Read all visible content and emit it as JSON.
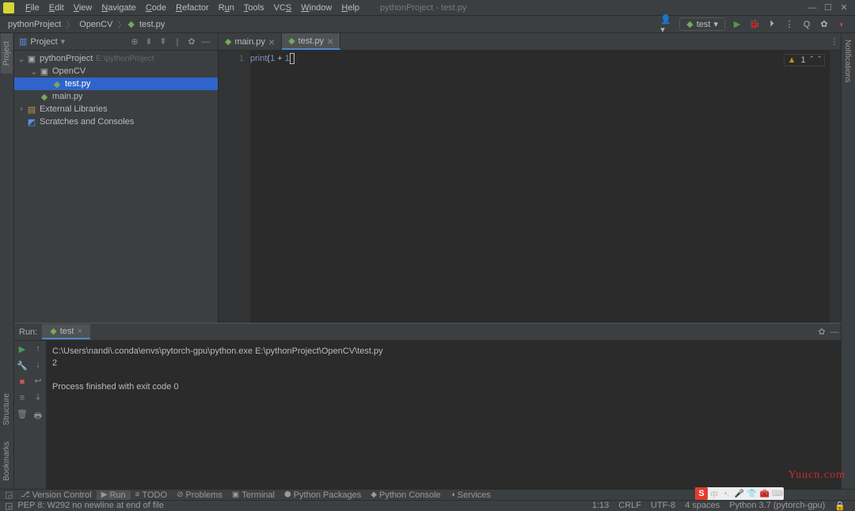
{
  "window": {
    "title": "pythonProject - test.py"
  },
  "menu": {
    "file": "File",
    "edit": "Edit",
    "view": "View",
    "navigate": "Navigate",
    "code": "Code",
    "refactor": "Refactor",
    "run": "Run",
    "tools": "Tools",
    "vcs": "VCS",
    "window": "Window",
    "help": "Help"
  },
  "breadcrumbs": {
    "p0": "pythonProject",
    "p1": "OpenCV",
    "p2": "test.py"
  },
  "run_config": {
    "name": "test"
  },
  "project_panel": {
    "title": "Project",
    "root": {
      "name": "pythonProject",
      "path": "E:\\pythonProject"
    },
    "opencv": "OpenCV",
    "testpy": "test.py",
    "mainpy": "main.py",
    "ext": "External Libraries",
    "scratches": "Scratches and Consoles"
  },
  "editor": {
    "tabs": [
      {
        "name": "main.py",
        "active": false
      },
      {
        "name": "test.py",
        "active": true
      }
    ],
    "line_number": "1",
    "code": {
      "fn": "print",
      "lp": "(",
      "n1": "1",
      "op": " + ",
      "n2": "1",
      "rp": ")"
    },
    "inspection": {
      "warnings": "1",
      "up": "ˆ",
      "down": "ˇ"
    }
  },
  "left_tabs": {
    "project": "Project",
    "structure": "Structure",
    "bookmarks": "Bookmarks"
  },
  "right_tabs": {
    "notifications": "Notifications"
  },
  "run_panel": {
    "label": "Run:",
    "tab": "test",
    "output_line1": "C:\\Users\\nandi\\.conda\\envs\\pytorch-gpu\\python.exe E:\\pythonProject\\OpenCV\\test.py",
    "output_line2": "2",
    "output_line3": "",
    "output_line4": "Process finished with exit code 0"
  },
  "bottom_tools": {
    "vcs": "Version Control",
    "run": "Run",
    "todo": "TODO",
    "problems": "Problems",
    "terminal": "Terminal",
    "pypkg": "Python Packages",
    "pyconsole": "Python Console",
    "services": "Services"
  },
  "status": {
    "msg": "PEP 8: W292 no newline at end of file",
    "pos": "1:13",
    "crlf": "CRLF",
    "enc": "UTF-8",
    "indent": "4 spaces",
    "interp": "Python 3.7 (pytorch-gpu)"
  },
  "ime": {
    "logo": "S",
    "lang": "中"
  },
  "watermark": "Yuucn.com"
}
